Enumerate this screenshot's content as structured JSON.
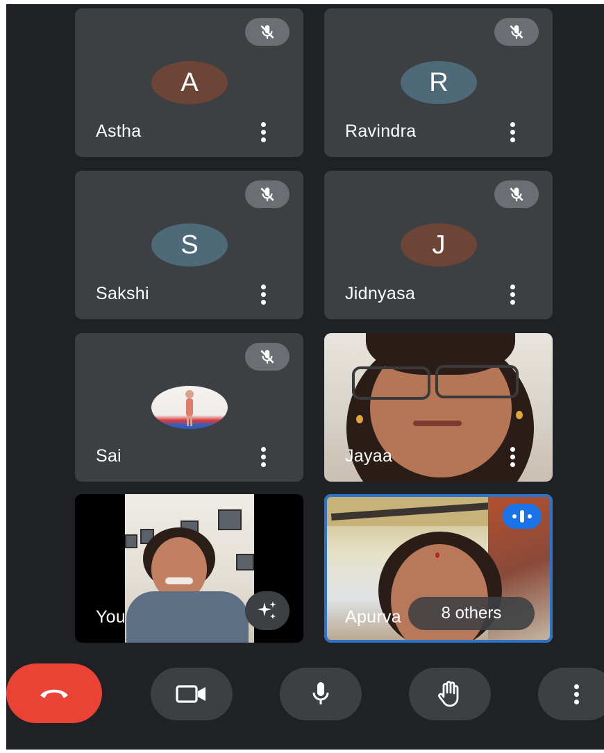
{
  "participants": [
    {
      "name": "Astha",
      "initial": "A",
      "avatar_color": "#6d4536",
      "muted": true
    },
    {
      "name": "Ravindra",
      "initial": "R",
      "avatar_color": "#4e6a78",
      "muted": true
    },
    {
      "name": "Sakshi",
      "initial": "S",
      "avatar_color": "#4e6a78",
      "muted": true
    },
    {
      "name": "Jidnyasa",
      "initial": "J",
      "avatar_color": "#6d4536",
      "muted": true
    },
    {
      "name": "Sai",
      "muted": true
    },
    {
      "name": "Jayaa",
      "muted": false
    }
  ],
  "self_tile": {
    "name": "You"
  },
  "speaker_tile": {
    "name": "Apurva",
    "others_label": "8 others"
  },
  "colors": {
    "background": "#202124",
    "tile": "#3c4043",
    "end_call": "#ea4335",
    "speaking": "#1a73e8"
  },
  "icons": {
    "mute": "mic-off-icon",
    "speaking": "audio-level-icon",
    "more": "more-vert-icon",
    "end_call": "phone-hangup-icon",
    "camera": "videocam-icon",
    "mic": "mic-icon",
    "hand": "raise-hand-icon",
    "effects": "sparkle-icon"
  }
}
